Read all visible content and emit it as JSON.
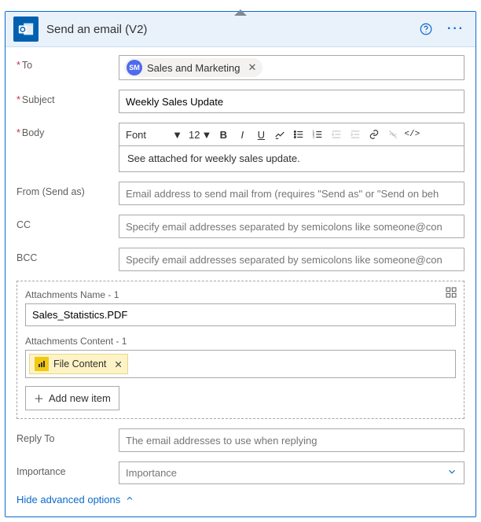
{
  "header": {
    "title": "Send an email (V2)"
  },
  "fields": {
    "to_label": "To",
    "to_chip_initials": "SM",
    "to_chip_name": "Sales and Marketing",
    "subject_label": "Subject",
    "subject_value": "Weekly Sales Update",
    "body_label": "Body",
    "body_text": "See attached for weekly sales update.",
    "font_label": "Font",
    "font_size": "12",
    "from_label": "From (Send as)",
    "from_placeholder": "Email address to send mail from (requires \"Send as\" or \"Send on beh",
    "cc_label": "CC",
    "cc_placeholder": "Specify email addresses separated by semicolons like someone@con",
    "bcc_label": "BCC",
    "bcc_placeholder": "Specify email addresses separated by semicolons like someone@con",
    "reply_label": "Reply To",
    "reply_placeholder": "The email addresses to use when replying",
    "importance_label": "Importance",
    "importance_value": "Importance"
  },
  "attachments": {
    "name_label": "Attachments Name - 1",
    "name_value": "Sales_Statistics.PDF",
    "content_label": "Attachments Content - 1",
    "token_label": "File Content",
    "add_label": "Add new item"
  },
  "footer": {
    "hide_label": "Hide advanced options"
  }
}
